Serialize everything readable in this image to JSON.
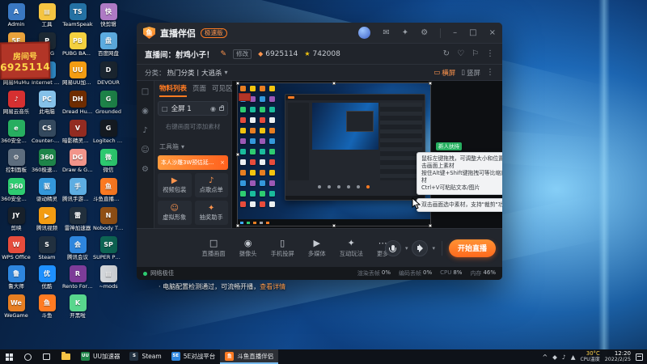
{
  "colors": {
    "accent": "#ff7b22",
    "banner_bg": "#b23527",
    "banner_text": "#ffd64a",
    "taskbar_bg": "#0e1116"
  },
  "room_banner": {
    "label": "房间号",
    "number": "6925114"
  },
  "desktop_icons": {
    "col1": [
      {
        "label": "Admin",
        "bg": "#3a78c2",
        "glyph": "A"
      },
      {
        "label": "5E对战平台",
        "bg": "#e9a23b",
        "glyph": "5E"
      },
      {
        "label": "网易MuMu",
        "bg": "#7d3c98",
        "glyph": "M"
      },
      {
        "label": "网易云音乐",
        "bg": "#d63031",
        "glyph": "♪"
      },
      {
        "label": "360安全浏览器",
        "bg": "#27ae60",
        "glyph": "e"
      },
      {
        "label": "控制面板",
        "bg": "#5d6d7e",
        "glyph": "⚙"
      },
      {
        "label": "360安全卫士",
        "bg": "#2ecc71",
        "glyph": "360"
      },
      {
        "label": "剪映",
        "bg": "#17202a",
        "glyph": "JY"
      },
      {
        "label": "WPS Office",
        "bg": "#e74c3c",
        "glyph": "W"
      },
      {
        "label": "鲁大师",
        "bg": "#2e86de",
        "glyph": "鲁"
      },
      {
        "label": "WeGame",
        "bg": "#e67e22",
        "glyph": "We"
      }
    ],
    "col2": [
      {
        "label": "工具",
        "bg": "#f5c542",
        "glyph": "▤"
      },
      {
        "label": "PUBG",
        "bg": "#1c2833",
        "glyph": "P"
      },
      {
        "label": "Internet Explorer",
        "bg": "#2e86c1",
        "glyph": "e"
      },
      {
        "label": "此电脑",
        "bg": "#85c1e9",
        "glyph": "PC"
      },
      {
        "label": "Counter-Strike: GO",
        "bg": "#34495e",
        "glyph": "CS"
      },
      {
        "label": "360极速浏览器",
        "bg": "#1e8449",
        "glyph": "360"
      },
      {
        "label": "驱动精灵",
        "bg": "#3498db",
        "glyph": "驱"
      },
      {
        "label": "腾讯视频",
        "bg": "#f39c12",
        "glyph": "▶"
      },
      {
        "label": "Steam",
        "bg": "#21303f",
        "glyph": "S"
      },
      {
        "label": "优酷",
        "bg": "#1e90ff",
        "glyph": "优"
      },
      {
        "label": "斗鱼",
        "bg": "#ff7b22",
        "glyph": "鱼"
      }
    ],
    "col3": [
      {
        "label": "TeamSpeak",
        "bg": "#2471a3",
        "glyph": "TS"
      },
      {
        "label": "PUBG BATTLEGROUNDS",
        "bg": "#f4d03f",
        "glyph": "PB"
      },
      {
        "label": "网易UU加速器",
        "bg": "#f39c12",
        "glyph": "UU"
      },
      {
        "label": "Dread Hunger",
        "bg": "#6e2c00",
        "glyph": "DH"
      },
      {
        "label": "暗影精灵控制中心",
        "bg": "#922b21",
        "glyph": "V"
      },
      {
        "label": "Draw & Guess",
        "bg": "#f1948a",
        "glyph": "DG"
      },
      {
        "label": "腾讯手游助手",
        "bg": "#5dade2",
        "glyph": "手"
      },
      {
        "label": "雷神加速器",
        "bg": "#212f3c",
        "glyph": "雷"
      },
      {
        "label": "腾讯会议",
        "bg": "#2e86de",
        "glyph": "会"
      },
      {
        "label": "Rento Fortune",
        "bg": "#7d3c98",
        "glyph": "R"
      },
      {
        "label": "开黑啦",
        "bg": "#58d68d",
        "glyph": "K"
      }
    ],
    "col4": [
      {
        "label": "快剪辑",
        "bg": "#af7ac5",
        "glyph": "快"
      },
      {
        "label": "百度网盘",
        "bg": "#5dade2",
        "glyph": "盘"
      },
      {
        "label": "DEVOUR",
        "bg": "#1b2631",
        "glyph": "D"
      },
      {
        "label": "Grounded",
        "bg": "#1e8449",
        "glyph": "G"
      },
      {
        "label": "Logitech G HUB",
        "bg": "#151b22",
        "glyph": "G"
      },
      {
        "label": "微信",
        "bg": "#2ecc71",
        "glyph": "微"
      },
      {
        "label": "斗鱼直播伴侣",
        "bg": "#ff7b22",
        "glyph": "鱼"
      },
      {
        "label": "Nobody The Turnaround",
        "bg": "#935116",
        "glyph": "N"
      },
      {
        "label": "SUPER PEOPLE CBT",
        "bg": "#0e6655",
        "glyph": "SP"
      },
      {
        "label": "~mods",
        "bg": "#d5d8dc",
        "glyph": "▤"
      }
    ]
  },
  "app": {
    "title": "直播伴侣",
    "badge": "极速版",
    "logo_glyph": "鱼",
    "info": {
      "room_label": "直播间：",
      "room_title": "射鸡小子！",
      "edit": "修改",
      "room_id": "6925114",
      "fans_id": "742008"
    },
    "category": {
      "label": "分类：",
      "value": "热门分类丨大逃杀",
      "landscape": "横屏",
      "portrait": "竖屏"
    },
    "rail": [
      {
        "glyph": "□"
      },
      {
        "glyph": "◉"
      },
      {
        "glyph": "♪"
      },
      {
        "glyph": "☺"
      },
      {
        "glyph": "⚙"
      }
    ],
    "sidebar": {
      "tabs": [
        {
          "label": "物料列表",
          "active": true
        },
        {
          "label": "页面"
        },
        {
          "label": "可见区"
        }
      ],
      "scene": "全屏 1",
      "add_hint": "右键画面可添加素材",
      "toolbox": "工具箱",
      "promo": "本人沙雕3W预估延迟上线啦",
      "features": [
        {
          "label": "视频包装",
          "glyph": "▶"
        },
        {
          "label": "点歌点单",
          "glyph": "♪"
        },
        {
          "label": "虚拟形象",
          "glyph": "☺"
        },
        {
          "label": "抽奖助手",
          "glyph": "✦"
        }
      ]
    },
    "toolbar": {
      "items": [
        {
          "label": "直播画面",
          "glyph": "□"
        },
        {
          "label": "摄像头",
          "glyph": "◉"
        },
        {
          "label": "手机投屏",
          "glyph": "▯"
        },
        {
          "label": "多媒体",
          "glyph": "▶"
        },
        {
          "label": "互动玩法",
          "glyph": "✦"
        },
        {
          "label": "更多",
          "glyph": "⋯"
        }
      ],
      "mic_label": "麦克风",
      "speaker_label": "扬声器",
      "start": "开始直播"
    },
    "status": {
      "left": "网络极佳",
      "metrics": [
        {
          "label": "渲染丢帧",
          "value": "0%"
        },
        {
          "label": "编码丢帧",
          "value": "0%"
        },
        {
          "label": "CPU",
          "value": "8%"
        },
        {
          "label": "内存",
          "value": "46%"
        }
      ]
    },
    "tooltip": {
      "lines": [
        "鼠标左键拖拽，可调整大小和位置，双击画面上素材",
        "按住Alt键+Shift键拖拽可等比缩放素材",
        "Ctrl+V可粘贴文本/图片"
      ],
      "tip2": "双击画面选中素材，支持\"裁剪\"功能"
    },
    "footer_tip": {
      "text": "· 电脑配置检测通过，可流畅开播，",
      "link": "查看详情"
    }
  },
  "preview": {
    "icon_palette": [
      "#e67e22",
      "#3498db",
      "#2ecc71",
      "#e74c3c",
      "#f1c40f",
      "#9b59b6",
      "#1abc9c",
      "#ecf0f1"
    ],
    "green_badge": "新人扶持"
  },
  "taskbar": {
    "apps": [
      {
        "label": "UU加速器",
        "bg": "#1e8449",
        "glyph": "UU"
      },
      {
        "label": "Steam",
        "bg": "#21303f",
        "glyph": "S"
      },
      {
        "label": "5E对战平台",
        "bg": "#2e86de",
        "glyph": "5E"
      },
      {
        "label": "斗鱼直播伴侣",
        "bg": "#ff7b22",
        "glyph": "鱼",
        "active": true
      }
    ],
    "tray": {
      "temp": "30°C",
      "temp_label": "CPU温度",
      "time": "12:20",
      "date": "2022/2/25"
    }
  },
  "icons": {
    "minimize": "–",
    "maximize": "□",
    "close": "×",
    "settings": "⚙",
    "message": "✉",
    "gift": "✦",
    "edit": "✎",
    "diamond": "◆",
    "star": "★",
    "caret": "▾",
    "more_v": "⋮",
    "refresh": "↻",
    "heart": "♡",
    "flag": "⚐",
    "eye": "◉",
    "scene": "□",
    "landscape": "▭",
    "portrait": "▯",
    "dropdown": "▾",
    "chevron_up": "^",
    "tray1": "◆",
    "tray2": "♪",
    "tray3": "▲",
    "promo_close": "×",
    "toolbox_caret": "▾"
  }
}
